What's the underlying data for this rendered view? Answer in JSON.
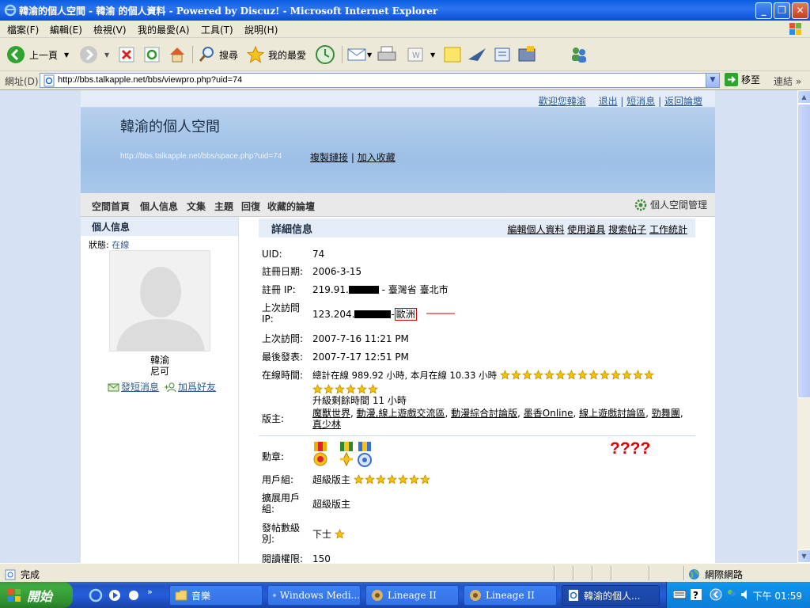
{
  "window": {
    "title": "韓渝的個人空間 - 韓渝 的個人資料 - Powered by Discuz! - Microsoft Internet Explorer"
  },
  "menu": [
    "檔案(F)",
    "編輯(E)",
    "檢視(V)",
    "我的最愛(A)",
    "工具(T)",
    "說明(H)"
  ],
  "toolbar": {
    "back_label": "上一頁",
    "search_label": "搜尋",
    "favorites_label": "我的最愛"
  },
  "address": {
    "label": "網址(D)",
    "url": "http://bbs.talkapple.net/bbs/viewpro.php?uid=74",
    "go_label": "移至",
    "links_label": "連結"
  },
  "page": {
    "toplinks": {
      "welcome": "歡迎您韓渝",
      "logout": "退出",
      "messages": "短消息",
      "back_forum": "返回論壇"
    },
    "space_name": "韓渝的個人空間",
    "space_url": "http://bbs.talkapple.net/bbs/space.php?uid=74",
    "copy_link": "複製鏈接",
    "add_fav": "加入收藏",
    "tabs": [
      "空間首頁",
      "個人信息",
      "文集",
      "主題",
      "回復",
      "收藏的論壇"
    ],
    "manage_label": "個人空間管理",
    "left": {
      "header": "個人信息",
      "status_label": "狀態:",
      "status_value": "在線",
      "username": "韓渝",
      "user_title": "尼可",
      "send_msg": "發短消息",
      "add_friend": "加爲好友"
    },
    "right": {
      "header": "詳細信息",
      "links": [
        "編輯個人資料",
        "使用道具",
        "搜索帖子",
        "工作統計"
      ],
      "uid_label": "UID:",
      "uid": "74",
      "reg_date_label": "註冊日期:",
      "reg_date": "2006-3-15",
      "reg_ip_label": "註冊 IP:",
      "reg_ip_prefix": "219.91.",
      "reg_ip_location": "- 臺灣省 臺北市",
      "last_ip_label": "上次訪問 IP:",
      "last_ip_prefix": "123.204.",
      "last_ip_location": "歐洲",
      "annotation": "????",
      "last_visit_label": "上次訪問:",
      "last_visit": "2007-7-16 11:21 PM",
      "last_post_label": "最後發表:",
      "last_post": "2007-7-17 12:51 PM",
      "online_label": "在線時間:",
      "online_text": "總計在線 989.92 小時, 本月在線 10.33 小時",
      "online_stars_row1": 14,
      "online_stars_row2": 6,
      "upgrade_text": "升級剩餘時間 11 小時",
      "moderator_label": "版主:",
      "moderator_forums": [
        "魔獸世界",
        "動漫,線上遊戲交流區",
        "動漫綜合討論版",
        "墨香Online",
        "線上遊戲討論區",
        "勁舞團",
        "真少林"
      ],
      "medals_label": "勳章:",
      "usergroup_label": "用戶組:",
      "usergroup": "超級版主",
      "usergroup_stars": 7,
      "ext_group_label": "擴展用戶組:",
      "ext_group": "超級版主",
      "post_level_label": "發帖數級別:",
      "post_level": "下士",
      "post_level_stars": 1,
      "read_perm_label": "閱讀權限:",
      "read_perm": "150"
    }
  },
  "statusbar": {
    "done": "完成",
    "zone": "網際網路"
  },
  "taskbar": {
    "start": "開始",
    "tasks": [
      "音樂",
      "Windows Medi...",
      "Lineage II",
      "Lineage II",
      "韓渝的個人..."
    ],
    "clock": "下午 01:59"
  },
  "colors": {
    "annotation_red": "#e10000",
    "banner_blue": "#9dbfe6",
    "star_yellow": "#f5c400"
  }
}
